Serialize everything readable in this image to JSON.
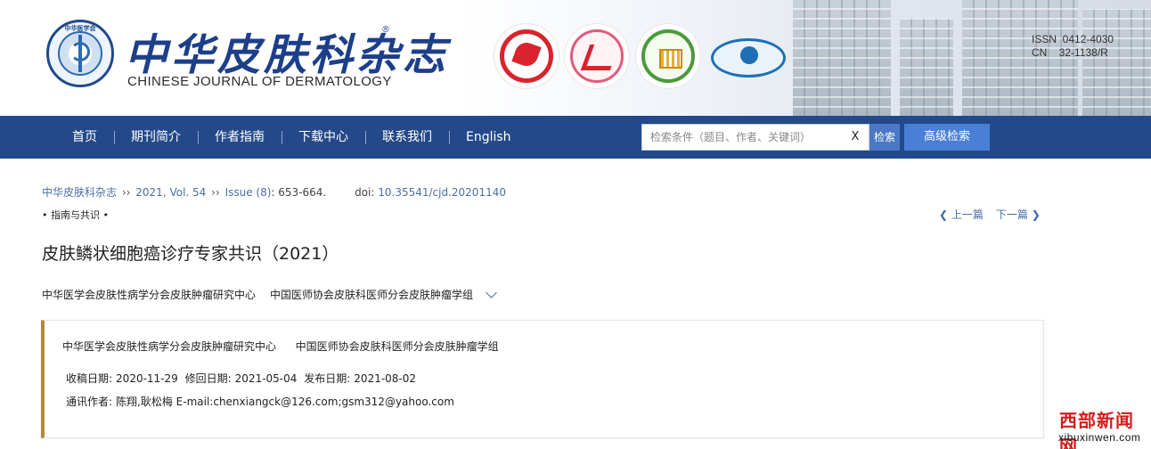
{
  "header": {
    "title_cn": "中华皮肤科杂志",
    "registered_mark": "®",
    "title_en": "CHINESE JOURNAL OF DERMATOLOGY",
    "emblem_text": "中华医学会",
    "issn": "ISSN  0412-4030",
    "cn": "CN    32-1138/R",
    "partner_logos": [
      "partner-logo-1",
      "partner-logo-2",
      "partner-logo-3",
      "partner-logo-4"
    ]
  },
  "nav": {
    "items": [
      "首页",
      "期刊简介",
      "作者指南",
      "下载中心",
      "联系我们",
      "English"
    ],
    "search_placeholder": "检索条件（题目、作者、关键词）",
    "clear_label": "X",
    "search_label": "检索",
    "advanced_label": "高级检索"
  },
  "breadcrumb": {
    "journal": "中华皮肤科杂志",
    "sep": "››",
    "year": "2021, Vol. 54",
    "issue": "Issue (8)",
    "pages": ": 653-664.",
    "doi_label": "doi:",
    "doi_value": "10.35541/cjd.20201140"
  },
  "section_tag": "• 指南与共识 •",
  "pager": {
    "prev": "上一篇",
    "next": "下一篇"
  },
  "article": {
    "title": "皮肤鳞状细胞癌诊疗专家共识（2021）",
    "authors": [
      "中华医学会皮肤性病学分会皮肤肿瘤研究中心",
      "中国医师协会皮肤科医师分会皮肤肿瘤学组"
    ]
  },
  "card": {
    "affiliations": [
      "中华医学会皮肤性病学分会皮肤肿瘤研究中心",
      "中国医师协会皮肤科医师分会皮肤肿瘤学组"
    ],
    "received_label": "收稿日期:",
    "received": "2020-11-29",
    "revised_label": "修回日期:",
    "revised": "2021-05-04",
    "published_label": "发布日期:",
    "published": "2021-08-02",
    "corresponding_label": "通讯作者:",
    "corresponding": "陈翔,耿松梅 E-mail:chenxiangck@126.com;gsm312@yahoo.com"
  },
  "watermark": {
    "cn": "西部新闻网",
    "en": "xibuxinwen.com"
  },
  "colors": {
    "nav_bg": "#24498a",
    "title_blue": "#1d3f8a",
    "link_blue": "#4a6fa6",
    "card_accent": "#b8893a",
    "watermark_red": "#d11d1d"
  }
}
